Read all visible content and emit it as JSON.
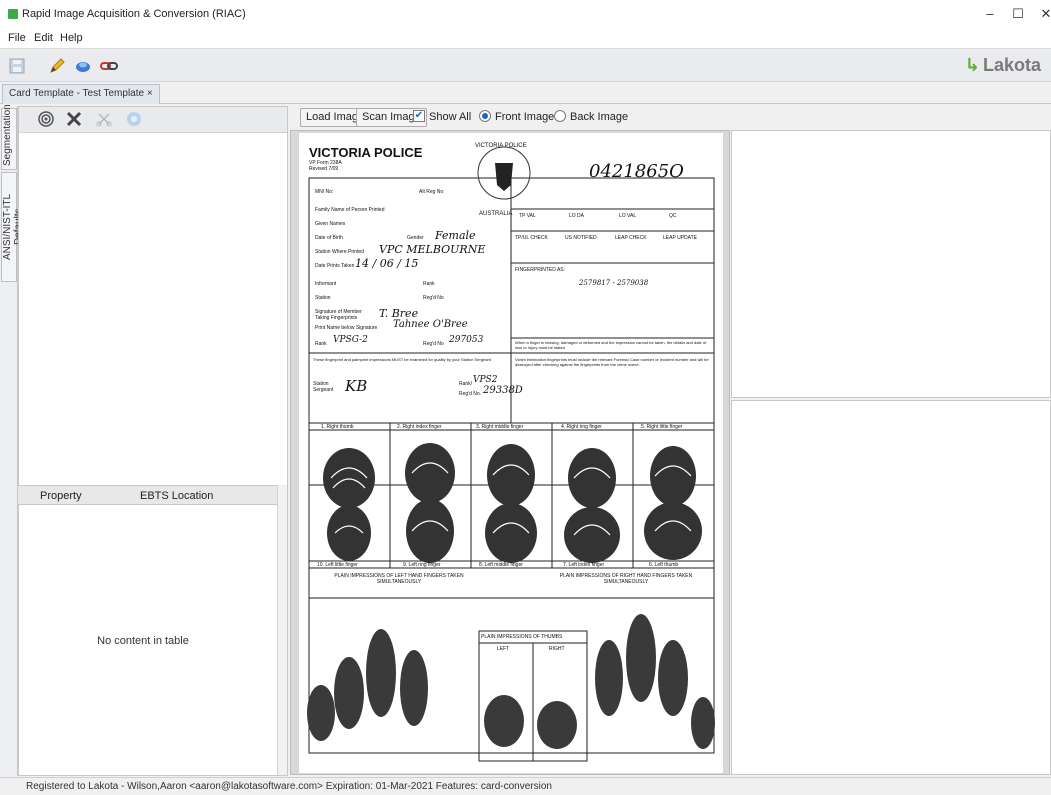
{
  "window": {
    "title": "Rapid Image Acquisition & Conversion (RIAC)",
    "min_symbol": "–",
    "max_symbol": "☐",
    "close_symbol": "✕"
  },
  "menu": {
    "items": [
      "File",
      "Edit",
      "Help"
    ]
  },
  "toolbar": {
    "icons": [
      "save-icon",
      "pen-icon",
      "stamp-icon",
      "link-icon"
    ]
  },
  "brand": {
    "name": "Lakota",
    "mark": "↳",
    "color": "#5fae3a"
  },
  "tabs": [
    {
      "label": "Card Template - Test Template",
      "close": "×"
    }
  ],
  "side_tabs": [
    "Segmentation",
    "ANSI/NIST-ITL Defaults"
  ],
  "left_toolbar_icons": [
    "fingerprint-icon",
    "crossed-tools-icon",
    "scissors-icon",
    "settings-icon"
  ],
  "property_table": {
    "columns": [
      "Property",
      "EBTS Location"
    ],
    "empty_message": "No content in table"
  },
  "image_toolbar": {
    "load_label": "Load Image",
    "scan_label": "Scan Image",
    "show_all_label": "Show All",
    "show_all_checked": true,
    "front_label": "Front Image",
    "back_label": "Back Image",
    "selected": "front"
  },
  "card": {
    "agency": "VICTORIA POLICE",
    "form": "VP Form 238A",
    "revised": "Revised 7/09",
    "seal_top": "VICTORIA POLICE",
    "seal_bottom": "AUSTRALIA",
    "handwritten_number": "0421865O",
    "fields": [
      "MNI No:",
      "Alt Reg No:",
      "Family Name of Person Printed",
      "Given Names",
      "Date of Birth",
      "Gender",
      "Station Where Printed",
      "Date Prints Taken",
      "Informant",
      "Rank",
      "Station",
      "Reg'd No",
      "Signature of Member Taking Fingerprints",
      "Print Name below Signature",
      "Rank",
      "Reg'd No"
    ],
    "values": {
      "gender": "Female",
      "station": "VPC   MELBOURNE",
      "date": "14 / 06 / 15",
      "signature": "T. Bree",
      "print_name": "Tahnee  O'Bree",
      "rank": "VPSG-2",
      "regd": "297053"
    },
    "check_headers": [
      "TP VAL",
      "LO DA",
      "LO VAL",
      "QC",
      "TP/UL CHECK",
      "US NOTIFIED",
      "LEAP CHECK",
      "LEAP UPDATE"
    ],
    "fingerprinted_as": "FINGERPRINTED AS:",
    "fingerprinted_value": "2579817 - 2579038",
    "missing_note": "When a finger is missing, damaged or deformed and the impression cannot be taken, the details and date of loss or injury must be stated",
    "verify_note": "These fingerprint and palmprint impressions MUST be examined for quality by your Station Sergeant.",
    "victim_note": "Victim elimination fingerprints must include the relevant Forensic Case number or Incident number and will be destroyed after checking against the fingerprints from the crime scene.",
    "sergeant_label": "Station Sergeant",
    "sergeant_sig": "KB",
    "sergeant_rank_label": "Rank/",
    "sergeant_rank": "VPS2",
    "sergeant_reg_label": "Reg'd No.",
    "sergeant_reg": "29338D",
    "right_fingers": [
      "1. Right thumb",
      "2. Right index finger",
      "3. Right middle finger",
      "4. Right ring finger",
      "5. Right little finger"
    ],
    "left_fingers": [
      "10. Left little finger",
      "9. Left ring finger",
      "8. Left middle finger",
      "7. Left index finger",
      "6. Left thumb"
    ],
    "plain_left": "PLAIN IMPRESSIONS OF LEFT HAND FINGERS TAKEN SIMULTANEOUSLY",
    "plain_right": "PLAIN IMPRESSIONS OF RIGHT HAND FINGERS TAKEN SIMULTANEOUSLY",
    "plain_thumbs": "PLAIN IMPRESSIONS OF THUMBS",
    "thumb_left": "LEFT",
    "thumb_right": "RIGHT"
  },
  "status": {
    "text": "Registered to Lakota - Wilson,Aaron <aaron@lakotasoftware.com>  Expiration: 01-Mar-2021 Features: card-conversion"
  }
}
